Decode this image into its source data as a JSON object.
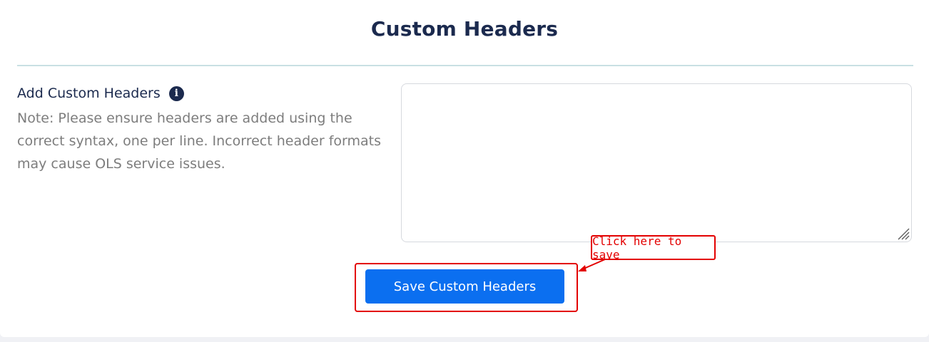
{
  "header": {
    "title": "Custom Headers"
  },
  "form": {
    "label": "Add Custom Headers",
    "info_icon": "info-circle-icon",
    "note": "Note: Please ensure headers are added using the correct syntax, one per line. Incorrect header formats may cause OLS service issues.",
    "textarea_value": "",
    "save_label": "Save Custom Headers"
  },
  "annotation": {
    "callout_text": "Click here to save",
    "color": "#e30000"
  },
  "colors": {
    "primary_button": "#0b6ff0",
    "heading": "#1b2a4e",
    "note_text": "#7d7d7d",
    "divider": "#c8e0e3"
  }
}
